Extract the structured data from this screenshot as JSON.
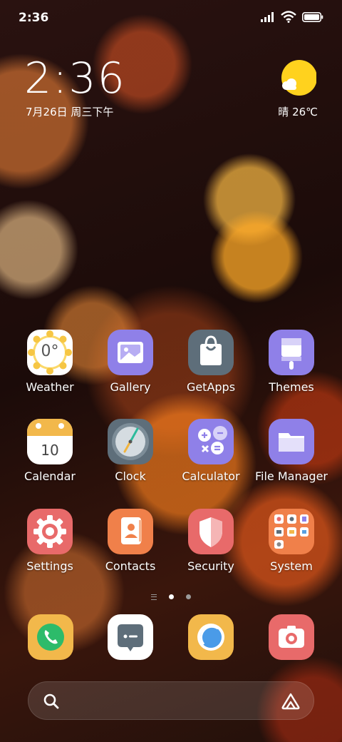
{
  "status_bar": {
    "time": "2:36"
  },
  "clock_widget": {
    "time": "2:36",
    "date": "7月26日 周三下午"
  },
  "weather_widget": {
    "text": "晴 26℃",
    "icon": "sunny-icon"
  },
  "apps": [
    {
      "id": "weather",
      "label": "Weather",
      "icon_text": "0°"
    },
    {
      "id": "gallery",
      "label": "Gallery"
    },
    {
      "id": "getapps",
      "label": "GetApps"
    },
    {
      "id": "themes",
      "label": "Themes"
    },
    {
      "id": "calendar",
      "label": "Calendar",
      "icon_text": "10"
    },
    {
      "id": "clock",
      "label": "Clock"
    },
    {
      "id": "calculator",
      "label": "Calculator"
    },
    {
      "id": "file-manager",
      "label": "File Manager"
    },
    {
      "id": "settings",
      "label": "Settings"
    },
    {
      "id": "contacts",
      "label": "Contacts"
    },
    {
      "id": "security",
      "label": "Security"
    },
    {
      "id": "system",
      "label": "System"
    }
  ],
  "page_indicator": {
    "pages": 2,
    "active": 1
  },
  "dock": [
    {
      "id": "phone",
      "icon": "phone-icon"
    },
    {
      "id": "messages",
      "icon": "messages-icon"
    },
    {
      "id": "browser",
      "icon": "browser-icon"
    },
    {
      "id": "camera",
      "icon": "camera-icon"
    }
  ],
  "search_bar": {
    "left_icon": "search-icon",
    "right_icon": "assistant-icon"
  },
  "colors": {
    "weather_sun": "#FFD21E",
    "purple_icon": "#8F80E8",
    "gray_icon": "#5E6E7A",
    "orange_icon": "#F0804A",
    "red_icon": "#E86A6A",
    "yellow_icon": "#F2B84B"
  }
}
